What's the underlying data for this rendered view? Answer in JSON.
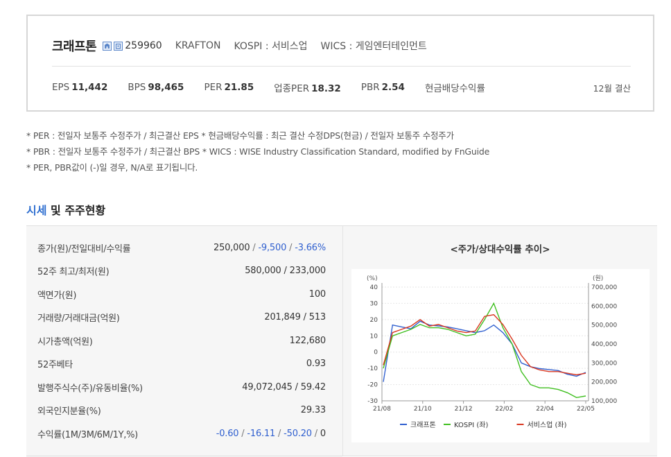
{
  "summary": {
    "name": "크래프톤",
    "code": "259960",
    "english_name": "KRAFTON",
    "market": "KOSPI : 서비스업",
    "wics": "WICS : 게임엔터테인먼트",
    "icons": [
      "building-icon",
      "building-alt-icon"
    ],
    "metrics": [
      {
        "label": "EPS",
        "value": "11,442"
      },
      {
        "label": "BPS",
        "value": "98,465"
      },
      {
        "label": "PER",
        "value": "21.85"
      },
      {
        "label": "업종PER",
        "value": "18.32"
      },
      {
        "label": "PBR",
        "value": "2.54"
      },
      {
        "label": "현금배당수익률",
        "value": ""
      }
    ],
    "settlement": "12월 결산"
  },
  "notes": [
    "* PER : 전일자 보통주 수정주가 / 최근결산 EPS * 현금배당수익률 : 최근 결산 수정DPS(현금) / 전일자 보통주 수정주가",
    "* PBR : 전일자 보통주 수정주가 / 최근결산 BPS * WICS : WISE Industry Classification Standard, modified by FnGuide",
    "* PER, PBR값이 (-)일 경우, N/A로 표기됩니다."
  ],
  "section": {
    "accent": "시세",
    "rest": " 및 주주현황"
  },
  "info_table": {
    "close_label": "종가(원)/전일대비/수익률",
    "close_values": [
      "250,000",
      "-9,500",
      "-3.66%"
    ],
    "rows": [
      {
        "label": "52주 최고/최저(원)",
        "value": "580,000 / 233,000"
      },
      {
        "label": "액면가(원)",
        "value": "100"
      },
      {
        "label": "거래량/거래대금(억원)",
        "value": "201,849 / 513"
      },
      {
        "label": "시가총액(억원)",
        "value": "122,680"
      },
      {
        "label": "52주베타",
        "value": "0.93"
      },
      {
        "label": "발행주식수(주)/유동비율(%)",
        "value": "49,072,045 / 59.42"
      },
      {
        "label": "외국인지분율(%)",
        "value": "29.33"
      }
    ],
    "return_label": "수익률(1M/3M/6M/1Y,%)",
    "return_values": [
      "-0.60",
      "-16.11",
      "-50.20",
      "0"
    ]
  },
  "chart_data": {
    "type": "line",
    "title": "<주가/상대수익률 추이>",
    "left_unit": "(%)",
    "right_unit": "(원)",
    "x_ticks": [
      "21/08",
      "21/10",
      "21/12",
      "22/02",
      "22/04",
      "22/05"
    ],
    "y_left_ticks": [
      40,
      30,
      20,
      10,
      0,
      -10,
      -20,
      -30
    ],
    "y_left_range": [
      -30,
      40
    ],
    "y_right_ticks": [
      "700,000",
      "600,000",
      "500,000",
      "400,000",
      "300,000",
      "200,000",
      "100,000"
    ],
    "y_right_range": [
      100000,
      700000
    ],
    "series": [
      {
        "name": "크래프톤",
        "axis": "right",
        "color": "#2f5fcf",
        "values": [
          200000,
          500000,
          490000,
          480000,
          520000,
          500000,
          495000,
          490000,
          480000,
          470000,
          460000,
          470000,
          500000,
          460000,
          400000,
          300000,
          280000,
          270000,
          265000,
          260000,
          240000,
          230000,
          250000
        ]
      },
      {
        "name": "KOSPI (좌)",
        "axis": "left",
        "color": "#3fbf1f",
        "values": [
          -10,
          10,
          12,
          14,
          17,
          15,
          15,
          14,
          12,
          10,
          11,
          20,
          30,
          15,
          5,
          -12,
          -20,
          -22,
          -22,
          -23,
          -25,
          -28,
          -27
        ]
      },
      {
        "name": "서비스업 (좌)",
        "axis": "left",
        "color": "#d9361f",
        "values": [
          -8,
          12,
          14,
          16,
          20,
          16,
          17,
          15,
          13,
          12,
          13,
          22,
          23,
          17,
          8,
          -2,
          -9,
          -11,
          -12,
          -12,
          -13,
          -14,
          -13
        ]
      }
    ]
  }
}
